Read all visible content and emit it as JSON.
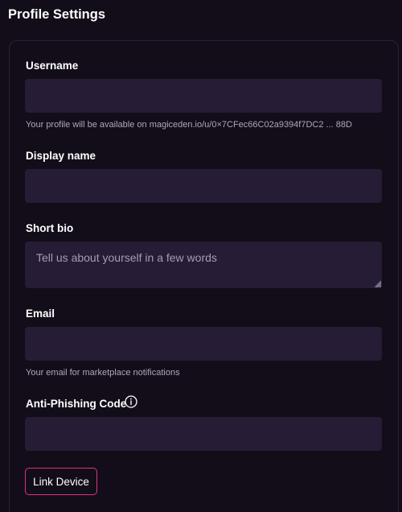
{
  "page": {
    "title": "Profile Settings"
  },
  "form": {
    "username": {
      "label": "Username",
      "value": "",
      "hint": "Your profile will be available on magiceden.io/u/0×7CFec66C02a9394f7DC2 ... 88D"
    },
    "display_name": {
      "label": "Display name",
      "value": ""
    },
    "short_bio": {
      "label": "Short bio",
      "placeholder": "Tell us about yourself in a few words",
      "value": ""
    },
    "email": {
      "label": "Email",
      "value": "",
      "hint": "Your email for marketplace notifications"
    },
    "anti_phishing": {
      "label": "Anti-Phishing Code",
      "value": ""
    },
    "link_device_label": "Link Device"
  },
  "colors": {
    "background": "#120d18",
    "input_bg": "#261c35",
    "accent_border": "#e0327e",
    "hint_text": "#b0a7bb"
  },
  "icons": {
    "anti_phishing_info": "info-circle-icon"
  }
}
